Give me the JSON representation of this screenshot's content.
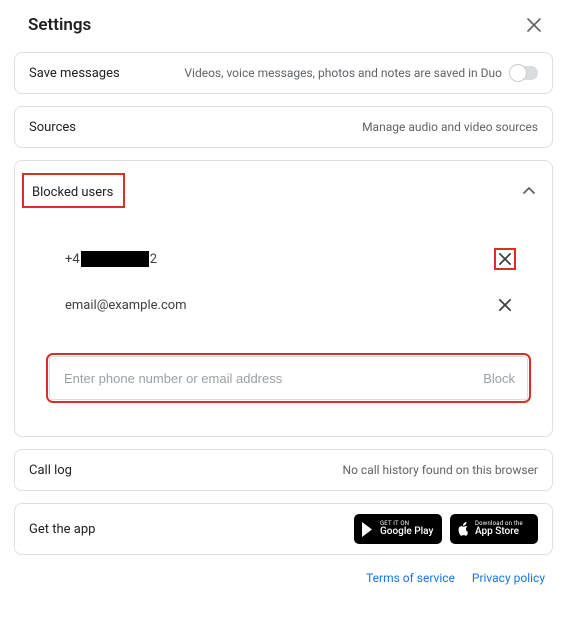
{
  "header": {
    "title": "Settings"
  },
  "save_messages": {
    "label": "Save messages",
    "desc": "Videos, voice messages, photos and notes are saved in Duo"
  },
  "sources": {
    "label": "Sources",
    "desc": "Manage audio and video sources"
  },
  "blocked": {
    "title": "Blocked users",
    "entries": [
      {
        "prefix": "+4",
        "suffix": "2"
      },
      {
        "text": "email@example.com"
      }
    ],
    "input_placeholder": "Enter phone number or email address",
    "block_label": "Block"
  },
  "call_log": {
    "label": "Call log",
    "desc": "No call history found on this browser"
  },
  "get_app": {
    "label": "Get the app",
    "google": {
      "small": "GET IT ON",
      "big": "Google Play"
    },
    "apple": {
      "small": "Download on the",
      "big": "App Store"
    }
  },
  "footer": {
    "terms": "Terms of service",
    "privacy": "Privacy policy"
  }
}
